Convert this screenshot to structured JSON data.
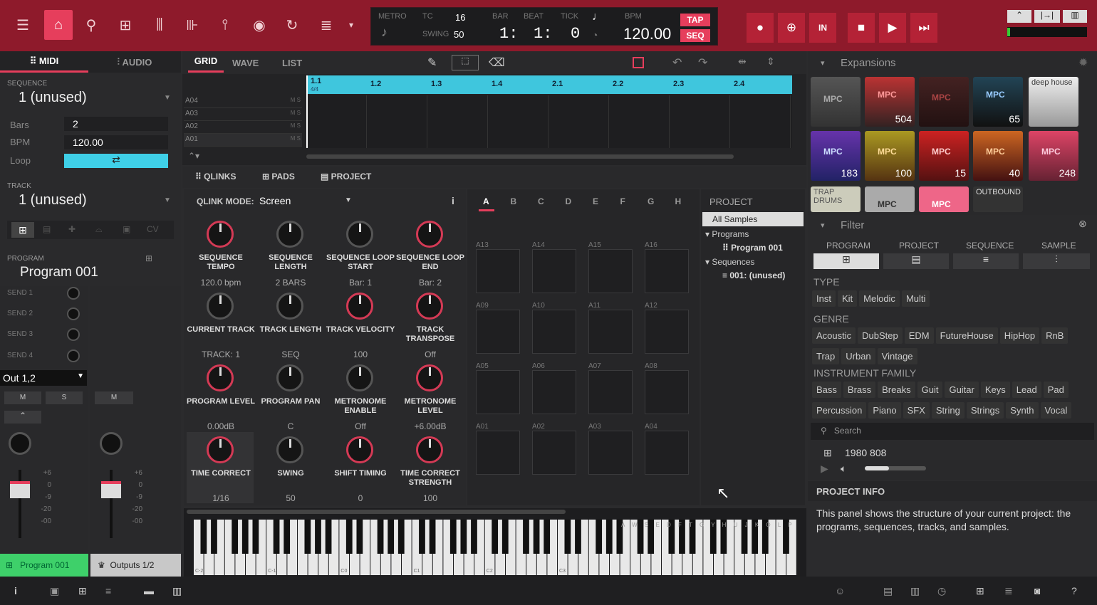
{
  "transport": {
    "metro": "METRO",
    "tc": "TC",
    "tc_val": "16",
    "swing_lbl": "SWING",
    "swing_val": "50",
    "bar": "BAR",
    "beat": "BEAT",
    "tick": "TICK",
    "bar_val": "1:",
    "beat_val": "1:",
    "tick_val": "0",
    "bpm_lbl": "BPM",
    "bpm_val": "120.00",
    "tap": "TAP",
    "seq": "SEQ"
  },
  "top_buttons": {
    "in": "IN"
  },
  "left": {
    "midi": "MIDI",
    "audio": "AUDIO",
    "sequence_lbl": "SEQUENCE",
    "sequence": "1 (unused)",
    "bars_lbl": "Bars",
    "bars": "2",
    "bpm_lbl": "BPM",
    "bpm": "120.00",
    "loop_lbl": "Loop",
    "track_lbl": "TRACK",
    "track": "1 (unused)",
    "cv": "CV",
    "program_lbl": "PROGRAM",
    "program": "Program 001",
    "sends": [
      "SEND 1",
      "SEND 2",
      "SEND 3",
      "SEND 4"
    ],
    "out": "Out 1,2",
    "m": "M",
    "s": "S",
    "db_marks": [
      "+6",
      "0",
      "-9",
      "-20",
      "-00"
    ],
    "ch1": "Program 001",
    "ch2": "Outputs 1/2"
  },
  "grid": {
    "tabs": [
      "GRID",
      "WAVE",
      "LIST"
    ],
    "tracks": [
      "A04",
      "A03",
      "A02",
      "A01"
    ],
    "ms": [
      "M",
      "S"
    ],
    "bars": [
      "1.1",
      "1.2",
      "1.3",
      "1.4",
      "2.1",
      "2.2",
      "2.3",
      "2.4"
    ],
    "sig": "4/4"
  },
  "qlinks": {
    "tabs": [
      "QLINKS",
      "PADS",
      "PROJECT"
    ],
    "mode_lbl": "QLINK MODE:",
    "mode": "Screen",
    "info": "i",
    "knobs": [
      {
        "label": "SEQUENCE TEMPO",
        "value": "120.0 bpm",
        "red": true
      },
      {
        "label": "SEQUENCE LENGTH",
        "value": "2 BARS",
        "red": false
      },
      {
        "label": "SEQUENCE LOOP START",
        "value": "Bar: 1",
        "red": false
      },
      {
        "label": "SEQUENCE LOOP END",
        "value": "Bar: 2",
        "red": true
      },
      {
        "label": "CURRENT TRACK",
        "value": "TRACK: 1",
        "red": false
      },
      {
        "label": "TRACK LENGTH",
        "value": "SEQ",
        "red": false
      },
      {
        "label": "TRACK VELOCITY",
        "value": "100",
        "red": true
      },
      {
        "label": "TRACK TRANSPOSE",
        "value": "Off",
        "red": true
      },
      {
        "label": "PROGRAM LEVEL",
        "value": "0.00dB",
        "red": true
      },
      {
        "label": "PROGRAM PAN",
        "value": "C",
        "red": false
      },
      {
        "label": "METRONOME ENABLE",
        "value": "Off",
        "red": false
      },
      {
        "label": "METRONOME LEVEL",
        "value": "+6.00dB",
        "red": true
      },
      {
        "label": "TIME CORRECT",
        "value": "1/16",
        "red": true
      },
      {
        "label": "SWING",
        "value": "50",
        "red": false
      },
      {
        "label": "SHIFT TIMING",
        "value": "0",
        "red": true
      },
      {
        "label": "TIME CORRECT STRENGTH",
        "value": "100",
        "red": true
      }
    ]
  },
  "pads": {
    "banks": [
      "A",
      "B",
      "C",
      "D",
      "E",
      "F",
      "G",
      "H"
    ],
    "labels": [
      "A13",
      "A14",
      "A15",
      "A16",
      "A09",
      "A10",
      "A11",
      "A12",
      "A05",
      "A06",
      "A07",
      "A08",
      "A01",
      "A02",
      "A03",
      "A04"
    ]
  },
  "project": {
    "title": "PROJECT",
    "all": "All Samples",
    "programs": "Programs",
    "program": "Program 001",
    "sequences": "Sequences",
    "seq": "001: (unused)"
  },
  "piano": {
    "octaves": [
      "C-2",
      "C-1",
      "C0",
      "C1",
      "C2",
      "C3"
    ],
    "keys": "A W S E D F T G Y H U J K O L P"
  },
  "expansions": {
    "title": "Expansions",
    "nums": [
      "504",
      "65",
      "183",
      "100",
      "15",
      "40",
      "248"
    ],
    "thumb_texts": [
      "MPC",
      "deep house",
      "TRAP DRUMS",
      "OUTBOUND"
    ]
  },
  "filter": {
    "title": "Filter",
    "cols": [
      "PROGRAM",
      "PROJECT",
      "SEQUENCE",
      "SAMPLE"
    ],
    "type_lbl": "TYPE",
    "types": [
      "Inst",
      "Kit",
      "Melodic",
      "Multi"
    ],
    "genre_lbl": "GENRE",
    "genres": [
      "Acoustic",
      "DubStep",
      "EDM",
      "FutureHouse",
      "HipHop",
      "RnB",
      "Trap",
      "Urban",
      "Vintage"
    ],
    "family_lbl": "INSTRUMENT FAMILY",
    "families": [
      "Bass",
      "Brass",
      "Breaks",
      "Guit",
      "Guitar",
      "Keys",
      "Lead",
      "Pad",
      "Percussion",
      "Piano",
      "SFX",
      "String",
      "Strings",
      "Synth",
      "Vocal"
    ],
    "search": "Search",
    "result": "1980 808"
  },
  "info": {
    "title": "PROJECT INFO",
    "text": "This panel shows the structure of your current project: the programs, sequences, tracks, and samples."
  },
  "colors": {
    "accent": "#e63e5c",
    "topbar": "#8e1a2b",
    "cyan": "#3fd0e8"
  }
}
